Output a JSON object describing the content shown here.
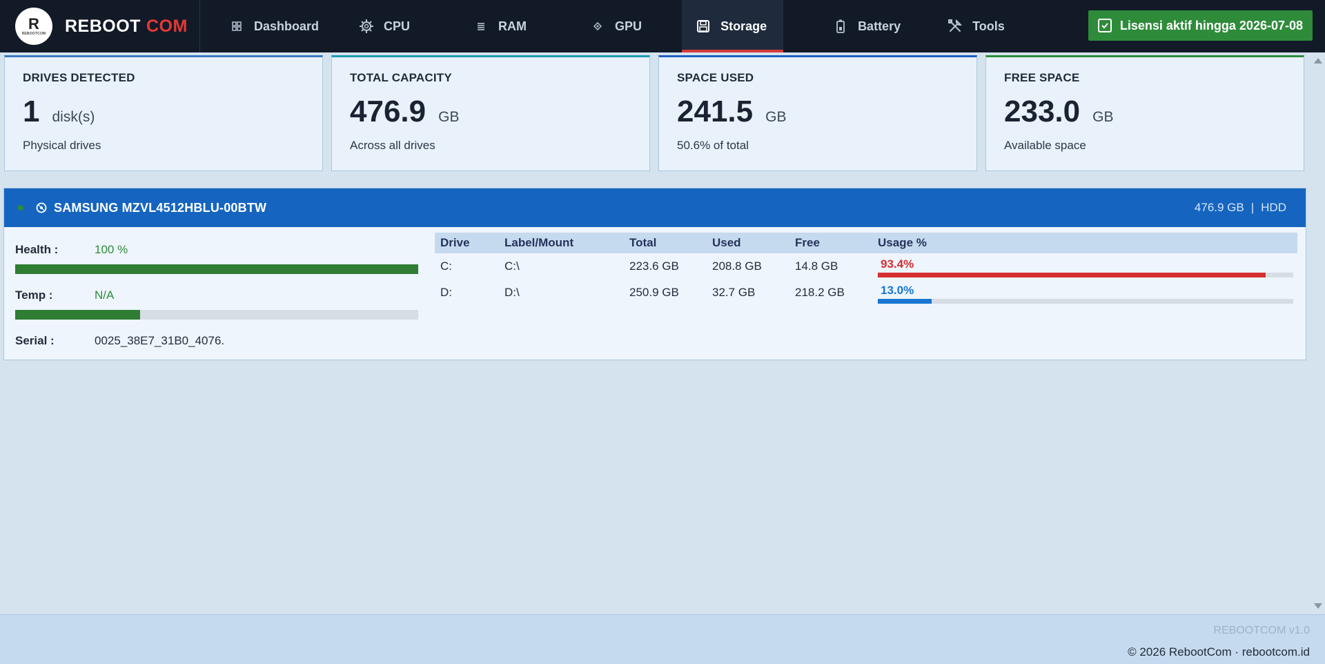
{
  "app": {
    "logo_letter": "R",
    "logo_small": "REBOOTCOM",
    "brand_main": "REBOOT",
    "brand_accent": "COM"
  },
  "nav": [
    {
      "label": "Dashboard",
      "icon": "grid-icon",
      "active": false
    },
    {
      "label": "CPU",
      "icon": "cpu-icon",
      "active": false
    },
    {
      "label": "RAM",
      "icon": "ram-icon",
      "active": false
    },
    {
      "label": "GPU",
      "icon": "gpu-icon",
      "active": false
    },
    {
      "label": "Storage",
      "icon": "floppy-icon",
      "active": true
    },
    {
      "label": "Battery",
      "icon": "battery-icon",
      "active": false
    },
    {
      "label": "Tools",
      "icon": "tools-icon",
      "active": false
    }
  ],
  "license": {
    "label": "Lisensi aktif hingga 2026-07-08",
    "color": "#2e8b3a"
  },
  "cards": [
    {
      "title": "DRIVES DETECTED",
      "value": "1",
      "unit": "disk(s)",
      "sub": "Physical drives"
    },
    {
      "title": "TOTAL CAPACITY",
      "value": "476.9",
      "unit": "GB",
      "sub": "Across all drives"
    },
    {
      "title": "SPACE USED",
      "value": "241.5",
      "unit": "GB",
      "sub": "50.6% of total"
    },
    {
      "title": "FREE SPACE",
      "value": "233.0",
      "unit": "GB",
      "sub": "Available space"
    }
  ],
  "drive": {
    "name": "SAMSUNG MZVL4512HBLU-00BTW",
    "size": "476.9 GB",
    "separator": "|",
    "type": "HDD",
    "health_label": "Health :",
    "health_value": "100 %",
    "health_fraction": 1.0,
    "temp_label": "Temp :",
    "temp_value": "N/A",
    "temp_fraction": 0.31,
    "serial_label": "Serial :",
    "serial_value": "0025_38E7_31B0_4076."
  },
  "partitions": {
    "headers": [
      "Drive",
      "Label/Mount",
      "Total",
      "Used",
      "Free",
      "Usage %"
    ],
    "rows": [
      {
        "drive": "C:",
        "mount": "C:\\",
        "total": "223.6 GB",
        "used": "208.8 GB",
        "free": "14.8 GB",
        "usage_label": "93.4%",
        "usage_fraction": 0.934,
        "color": "#d32f2f"
      },
      {
        "drive": "D:",
        "mount": "D:\\",
        "total": "250.9 GB",
        "used": "32.7 GB",
        "free": "218.2 GB",
        "usage_label": "13.0%",
        "usage_fraction": 0.13,
        "color": "#1976d2"
      }
    ]
  },
  "footer": {
    "version": "REBOOTCOM v1.0",
    "copyright": "© 2026 RebootCom · rebootcom.id"
  }
}
